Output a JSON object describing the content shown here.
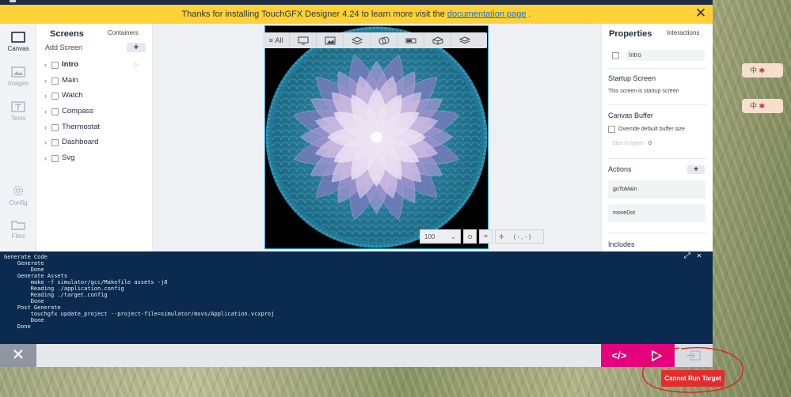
{
  "banner": {
    "text_before": "Thanks for installing TouchGFX Designer 4.24 to learn more visit the",
    "link": "documentation page",
    "text_after": ".",
    "close_icon": "close-icon"
  },
  "leftnav": {
    "items": [
      {
        "label": "Canvas",
        "icon": "canvas-icon",
        "active": true
      },
      {
        "label": "Images",
        "icon": "image-icon",
        "active": false
      },
      {
        "label": "Texts",
        "icon": "text-icon",
        "active": false
      },
      {
        "label": "Config",
        "icon": "gear-icon",
        "active": false
      },
      {
        "label": "Files",
        "icon": "folder-icon",
        "active": false
      }
    ]
  },
  "screens": {
    "title": "Screens",
    "containers_tab": "Containers",
    "add_label": "Add Screen",
    "add_button": "+",
    "items": [
      {
        "label": "Intro",
        "active": true
      },
      {
        "label": "Main",
        "active": false
      },
      {
        "label": "Watch",
        "active": false
      },
      {
        "label": "Compass",
        "active": false
      },
      {
        "label": "Thermostat",
        "active": false
      },
      {
        "label": "Dashboard",
        "active": false
      },
      {
        "label": "Svg",
        "active": false
      }
    ]
  },
  "canvas": {
    "filter_all": "All",
    "zoom_value": "100",
    "coords": "( - , - )",
    "toolbar_icons": [
      "image-filter-icon",
      "image-icon",
      "stack-icon",
      "shapes-icon",
      "progress-icon",
      "container-icon",
      "layers-icon"
    ]
  },
  "properties": {
    "title": "Properties",
    "interactions_tab": "Interactions",
    "screen_name": "Intro",
    "startup_title": "Startup Screen",
    "startup_text": "This screen is startup screen",
    "buffer_title": "Canvas Buffer",
    "buffer_checkbox": "Override default buffer size",
    "size_label": "Size in bytes",
    "size_value": "0",
    "actions_title": "Actions",
    "actions_add": "+",
    "actions": [
      "goToMain",
      "moveDot"
    ],
    "includes_title": "Includes"
  },
  "console": {
    "lines": [
      "Generate Code",
      "    Generate",
      "        Done",
      "    Generate Assets",
      "        make -f simulator/gcc/Makefile assets -j8",
      "        Reading ./application.config",
      "        Reading ./target.config",
      "        Done",
      "    Post Generate",
      "        touchgfx update_project --project-file=simulator/msvs/Application.vcxproj",
      "        Done",
      "    Done"
    ]
  },
  "bottombar": {
    "code_label": "</>",
    "tooltip": "Cannot Run Target"
  },
  "desktop": {
    "tag1": "中",
    "tag2": "中"
  },
  "colors": {
    "banner": "#fed136",
    "accent": "#e6007e",
    "console_bg": "#0b2a4f",
    "tooltip_bg": "#e32d2d"
  }
}
